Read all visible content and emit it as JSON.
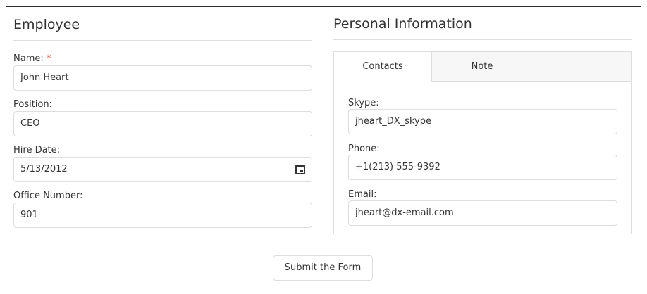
{
  "employee": {
    "title": "Employee",
    "name": {
      "label": "Name:",
      "required_mark": "*",
      "value": "John Heart"
    },
    "position": {
      "label": "Position:",
      "value": "CEO"
    },
    "hire_date": {
      "label": "Hire Date:",
      "value": "5/13/2012",
      "icon": "calendar-icon"
    },
    "office_number": {
      "label": "Office Number:",
      "value": "901"
    }
  },
  "personal": {
    "title": "Personal Information",
    "tabs": [
      {
        "label": "Contacts",
        "active": true
      },
      {
        "label": "Note",
        "active": false
      }
    ],
    "skype": {
      "label": "Skype:",
      "value": "jheart_DX_skype"
    },
    "phone": {
      "label": "Phone:",
      "value": "+1(213) 555-9392"
    },
    "email": {
      "label": "Email:",
      "value": "jheart@dx-email.com"
    }
  },
  "submit_label": "Submit the Form",
  "colors": {
    "required": "#d9534f",
    "border": "#dddddd",
    "frame": "#2d2d2d",
    "tab_bg": "#f7f7f7"
  }
}
